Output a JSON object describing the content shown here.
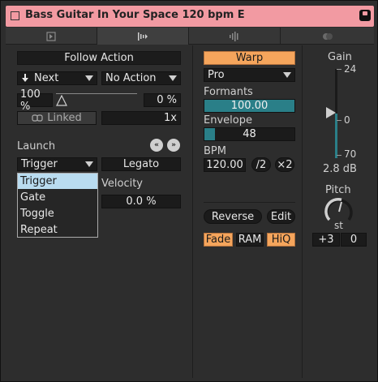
{
  "window": {
    "title": "Bass Guitar In Your Space 120 bpm E"
  },
  "tabs": [
    {
      "name": "clip-tab",
      "icon": "clip-square-icon",
      "active": false
    },
    {
      "name": "sample-tab",
      "icon": "sample-waveform-icon",
      "active": true
    },
    {
      "name": "audio-tab",
      "icon": "audio-waveform-icon",
      "active": false
    },
    {
      "name": "envelope-tab",
      "icon": "envelope-icon",
      "active": false
    }
  ],
  "follow_action": {
    "header": "Follow Action",
    "action_a": "Next",
    "action_b": "No Action",
    "chance_a": "100 %",
    "chance_b": "0 %",
    "linked_label": "Linked",
    "multiplier": "1x"
  },
  "launch": {
    "label": "Launch",
    "mode": "Trigger",
    "legato": "Legato",
    "velocity_label": "Velocity",
    "velocity_value": "0.0 %",
    "menu": {
      "items": [
        "Trigger",
        "Gate",
        "Toggle",
        "Repeat"
      ],
      "selected_index": 0
    }
  },
  "warp": {
    "button": "Warp",
    "mode": "Pro",
    "formants_label": "Formants",
    "formants_value": "100.00",
    "formants_fraction": 1.0,
    "envelope_label": "Envelope",
    "envelope_value": "48",
    "envelope_fraction": 0.12,
    "bpm_label": "BPM",
    "bpm_value": "120.00",
    "half": "/2",
    "double": "×2",
    "reverse": "Reverse",
    "edit": "Edit",
    "fade": "Fade",
    "ram": "RAM",
    "hiq": "HiQ"
  },
  "gain": {
    "label": "Gain",
    "max": "24",
    "zero": "0",
    "min": "70",
    "value": "2.8 dB"
  },
  "pitch": {
    "label": "Pitch",
    "unit": "st",
    "semitones": "+3",
    "cents": "0"
  },
  "colors": {
    "title_bar": "#f29aa2",
    "accent_orange": "#f5a55c",
    "teal": "#2a7f88",
    "menu_highlight": "#b9dcf0"
  }
}
